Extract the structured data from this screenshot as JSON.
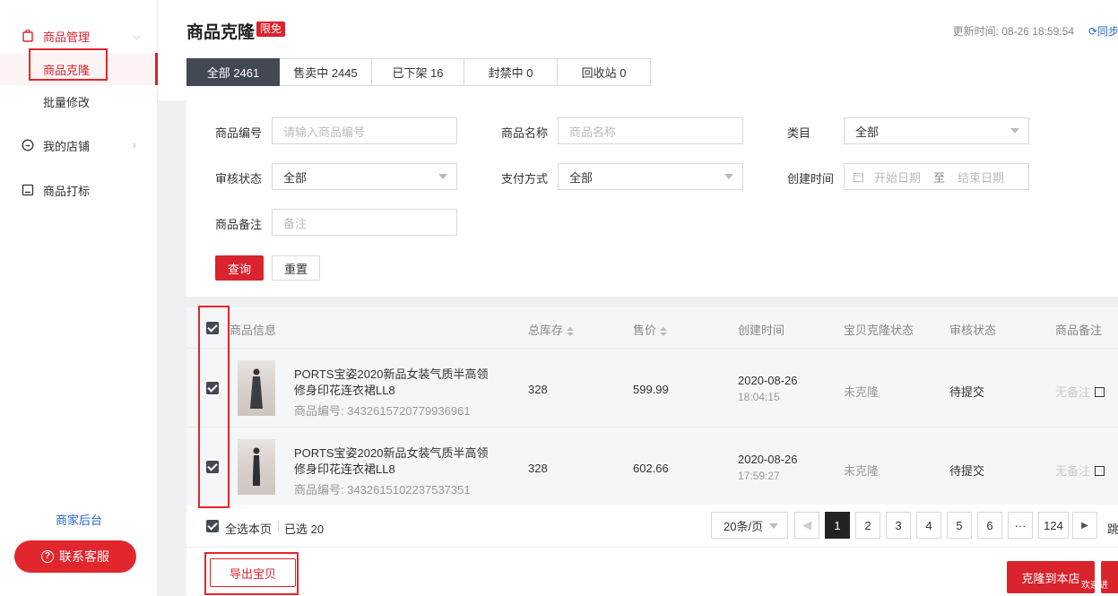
{
  "sidebar": {
    "group_goods": "商品管理",
    "sub_clone": "商品克隆",
    "sub_batch": "批量修改",
    "group_store": "我的店铺",
    "group_tag": "商品打标",
    "merchant_link": "商家后台",
    "contact_button": "联系客服"
  },
  "header": {
    "title": "商品克隆",
    "badge": "限免",
    "update_time": "更新时间: 08-26 18:59:54",
    "sync_link": "同步"
  },
  "tabs": [
    {
      "label": "全部 2461"
    },
    {
      "label": "售卖中 2445"
    },
    {
      "label": "已下架 16"
    },
    {
      "label": "封禁中 0"
    },
    {
      "label": "回收站 0"
    }
  ],
  "filters": {
    "goods_id_label": "商品编号",
    "goods_id_placeholder": "请输入商品编号",
    "goods_name_label": "商品名称",
    "goods_name_placeholder": "商品名称",
    "category_label": "类目",
    "category_value": "全部",
    "audit_label": "审核状态",
    "audit_value": "全部",
    "pay_label": "支付方式",
    "pay_value": "全部",
    "created_label": "创建时间",
    "start_date_placeholder": "开始日期",
    "range_sep": "至",
    "end_date_placeholder": "结束日期",
    "remark_label": "商品备注",
    "remark_placeholder": "备注",
    "query_button": "查询",
    "reset_button": "重置"
  },
  "table": {
    "columns": [
      "商品信息",
      "总库存",
      "售价",
      "创建时间",
      "宝贝克隆状态",
      "审核状态",
      "商品备注"
    ],
    "rows": [
      {
        "title_line1": "PORTS宝姿2020新品女装气质半高领",
        "title_line2": "修身印花连衣裙LL8",
        "goods_no": "商品编号: 3432615720779936961",
        "stock": "328",
        "price": "599.99",
        "date": "2020-08-26",
        "time": "18:04:15",
        "clone_status": "未克隆",
        "audit_status": "待提交",
        "remark": "无备注"
      },
      {
        "title_line1": "PORTS宝姿2020新品女装气质半高领",
        "title_line2": "修身印花连衣裙LL8",
        "goods_no": "商品编号: 3432615102237537351",
        "stock": "328",
        "price": "602.66",
        "date": "2020-08-26",
        "time": "17:59:27",
        "clone_status": "未克隆",
        "audit_status": "待提交",
        "remark": "无备注"
      }
    ]
  },
  "footer": {
    "select_page": "全选本页",
    "selected": "已选 20",
    "page_size": "20条/页",
    "pages": [
      "1",
      "2",
      "3",
      "4",
      "5",
      "6",
      "···",
      "124"
    ],
    "jump": "跳",
    "export_button": "导出宝贝",
    "clone_button": "克隆到本店",
    "welcome": "欢迎进"
  },
  "colors": {
    "accent": "#d9232d",
    "dark_tab": "#424854",
    "link": "#2266c7"
  }
}
